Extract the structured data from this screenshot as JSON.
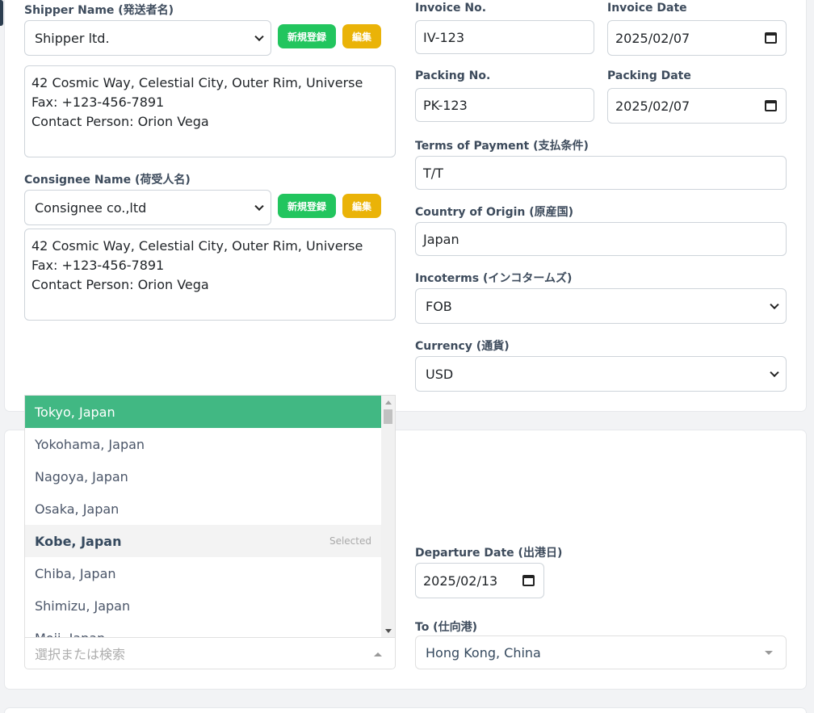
{
  "shipper": {
    "label": "Shipper Name (発送者名)",
    "selected": "Shipper ltd.",
    "new_button": "新規登録",
    "edit_button": "編集",
    "address_lines": [
      "42 Cosmic Way, Celestial City, Outer Rim, Universe",
      "Fax: +123-456-7891",
      "Contact Person: Orion Vega"
    ]
  },
  "consignee": {
    "label": "Consignee Name (荷受人名)",
    "selected": "Consignee co.,ltd",
    "new_button": "新規登録",
    "edit_button": "編集",
    "address_lines": [
      "42 Cosmic Way, Celestial City, Outer Rim, Universe",
      "Fax: +123-456-7891",
      "Contact Person: Orion Vega"
    ]
  },
  "invoice": {
    "no_label": "Invoice No.",
    "no_value": "IV-123",
    "date_label": "Invoice Date",
    "date_value": "2025/02/07"
  },
  "packing": {
    "no_label": "Packing No.",
    "no_value": "PK-123",
    "date_label": "Packing Date",
    "date_value": "2025/02/07"
  },
  "terms": {
    "label": "Terms of Payment (支払条件)",
    "value": "T/T"
  },
  "origin": {
    "label": "Country of Origin (原産国)",
    "value": "Japan"
  },
  "incoterms": {
    "label": "Incoterms (インコタームズ)",
    "value": "FOB"
  },
  "currency": {
    "label": "Currency (通貨)",
    "value": "USD"
  },
  "port_dropdown": {
    "placeholder": "選択または検索",
    "selected_hint": "Selected",
    "options": [
      "Tokyo, Japan",
      "Yokohama, Japan",
      "Nagoya, Japan",
      "Osaka, Japan",
      "Kobe, Japan",
      "Chiba, Japan",
      "Shimizu, Japan",
      "Moji, Japan"
    ]
  },
  "departure": {
    "label": "Departure Date (出港日)",
    "value": "2025/02/13"
  },
  "destination": {
    "label": "To (仕向港)",
    "value": "Hong Kong, China"
  }
}
